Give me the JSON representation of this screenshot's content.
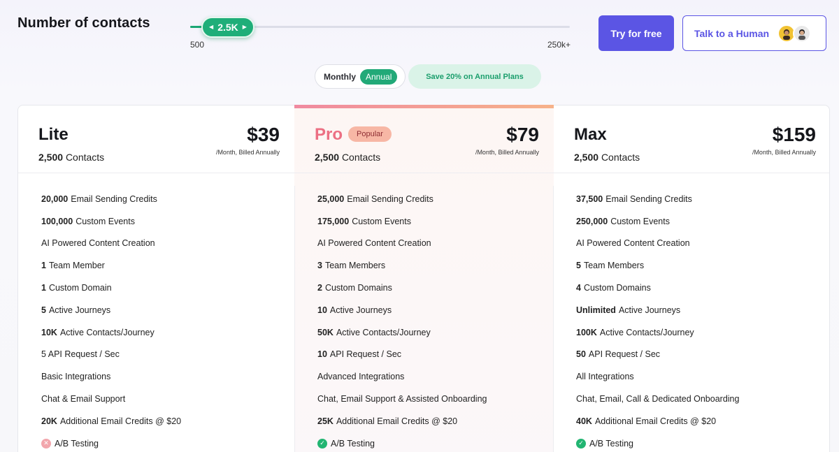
{
  "header": {
    "title": "Number of contacts",
    "slider": {
      "value_label": "2.5K",
      "min_label": "500",
      "max_label": "250k+",
      "fill_fraction": 0.04
    },
    "try_free_label": "Try for free",
    "talk_human_label": "Talk to a Human"
  },
  "billing": {
    "monthly_label": "Monthly",
    "annual_label": "Annual",
    "save_label": "Save 20% on Annual Plans"
  },
  "plans": [
    {
      "name": "Lite",
      "contacts_count": "2,500",
      "contacts_label": "Contacts",
      "price": "$39",
      "billing_note": "/Month, Billed Annually",
      "features": [
        {
          "bold": "20,000",
          "text": "Email Sending Credits"
        },
        {
          "bold": "100,000",
          "text": "Custom Events"
        },
        {
          "bold": "",
          "text": "AI Powered Content Creation"
        },
        {
          "bold": "1",
          "text": "Team Member"
        },
        {
          "bold": "1",
          "text": "Custom Domain"
        },
        {
          "bold": "5",
          "text": "Active Journeys"
        },
        {
          "bold": "10K",
          "text": "Active Contacts/Journey"
        },
        {
          "bold": "",
          "text": "5 API Request / Sec"
        },
        {
          "bold": "",
          "text": "Basic Integrations"
        },
        {
          "bold": "",
          "text": "Chat & Email Support"
        },
        {
          "bold": "20K",
          "text": "Additional Email Credits @ $20"
        },
        {
          "bold": "",
          "text": "A/B Testing",
          "icon": "x-circle-icon"
        }
      ]
    },
    {
      "name": "Pro",
      "badge": "Popular",
      "contacts_count": "2,500",
      "contacts_label": "Contacts",
      "price": "$79",
      "billing_note": "/Month, Billed Annually",
      "features": [
        {
          "bold": "25,000",
          "text": "Email Sending Credits"
        },
        {
          "bold": "175,000",
          "text": "Custom Events"
        },
        {
          "bold": "",
          "text": "AI Powered Content Creation"
        },
        {
          "bold": "3",
          "text": "Team Members"
        },
        {
          "bold": "2",
          "text": "Custom Domains"
        },
        {
          "bold": "10",
          "text": "Active Journeys"
        },
        {
          "bold": "50K",
          "text": "Active Contacts/Journey"
        },
        {
          "bold": "10",
          "text": "API Request / Sec"
        },
        {
          "bold": "",
          "text": "Advanced Integrations"
        },
        {
          "bold": "",
          "text": "Chat, Email Support & Assisted Onboarding"
        },
        {
          "bold": "25K",
          "text": "Additional Email Credits @ $20"
        },
        {
          "bold": "",
          "text": "A/B Testing",
          "icon": "check-circle-icon"
        }
      ]
    },
    {
      "name": "Max",
      "contacts_count": "2,500",
      "contacts_label": "Contacts",
      "price": "$159",
      "billing_note": "/Month, Billed Annually",
      "features": [
        {
          "bold": "37,500",
          "text": "Email Sending Credits"
        },
        {
          "bold": "250,000",
          "text": "Custom Events"
        },
        {
          "bold": "",
          "text": "AI Powered Content Creation"
        },
        {
          "bold": "5",
          "text": "Team Members"
        },
        {
          "bold": "4",
          "text": "Custom Domains"
        },
        {
          "bold": "Unlimited",
          "text": "Active Journeys"
        },
        {
          "bold": "100K",
          "text": "Active Contacts/Journey"
        },
        {
          "bold": "50",
          "text": "API Request / Sec"
        },
        {
          "bold": "",
          "text": "All Integrations"
        },
        {
          "bold": "",
          "text": "Chat, Email, Call & Dedicated Onboarding"
        },
        {
          "bold": "40K",
          "text": "Additional Email Credits @ $20"
        },
        {
          "bold": "",
          "text": "A/B Testing",
          "icon": "check-circle-icon"
        }
      ]
    }
  ],
  "colors": {
    "primary": "#5b55e4",
    "green": "#1fae79",
    "pro_accent": "#ec6f83"
  }
}
